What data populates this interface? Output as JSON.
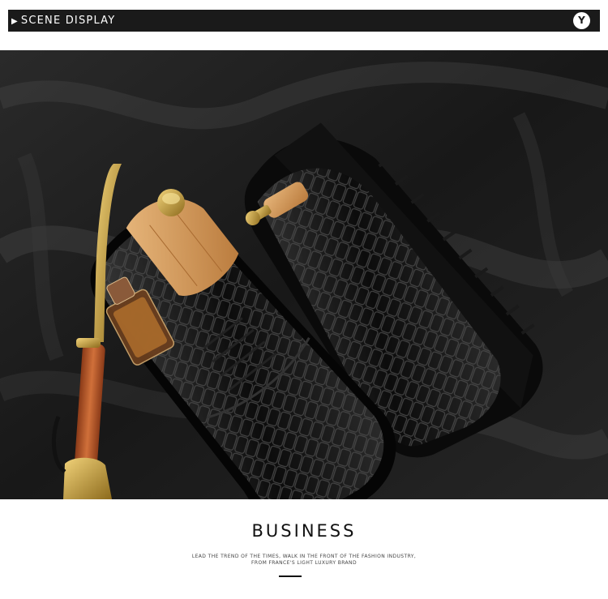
{
  "header": {
    "arrow": "▶",
    "title": "SCENE DISPLAY",
    "badge": "Y"
  },
  "caption": {
    "title": "BUSINESS",
    "line1": "LEAD THE TREND OF THE TIMES, WALK IN THE FRONT OF THE FASHION INDUSTRY,",
    "line2": "FROM FRANCE'S LIGHT LUXURY BRAND"
  },
  "colors": {
    "header_bg": "#1a1a1a",
    "satin_dark": "#141414",
    "satin_highlight": "#5a5a5a",
    "shoe_tree_wood": "#d39a5a",
    "shoe_horn_handle": "#b5562a",
    "gold": "#c9a23a"
  }
}
